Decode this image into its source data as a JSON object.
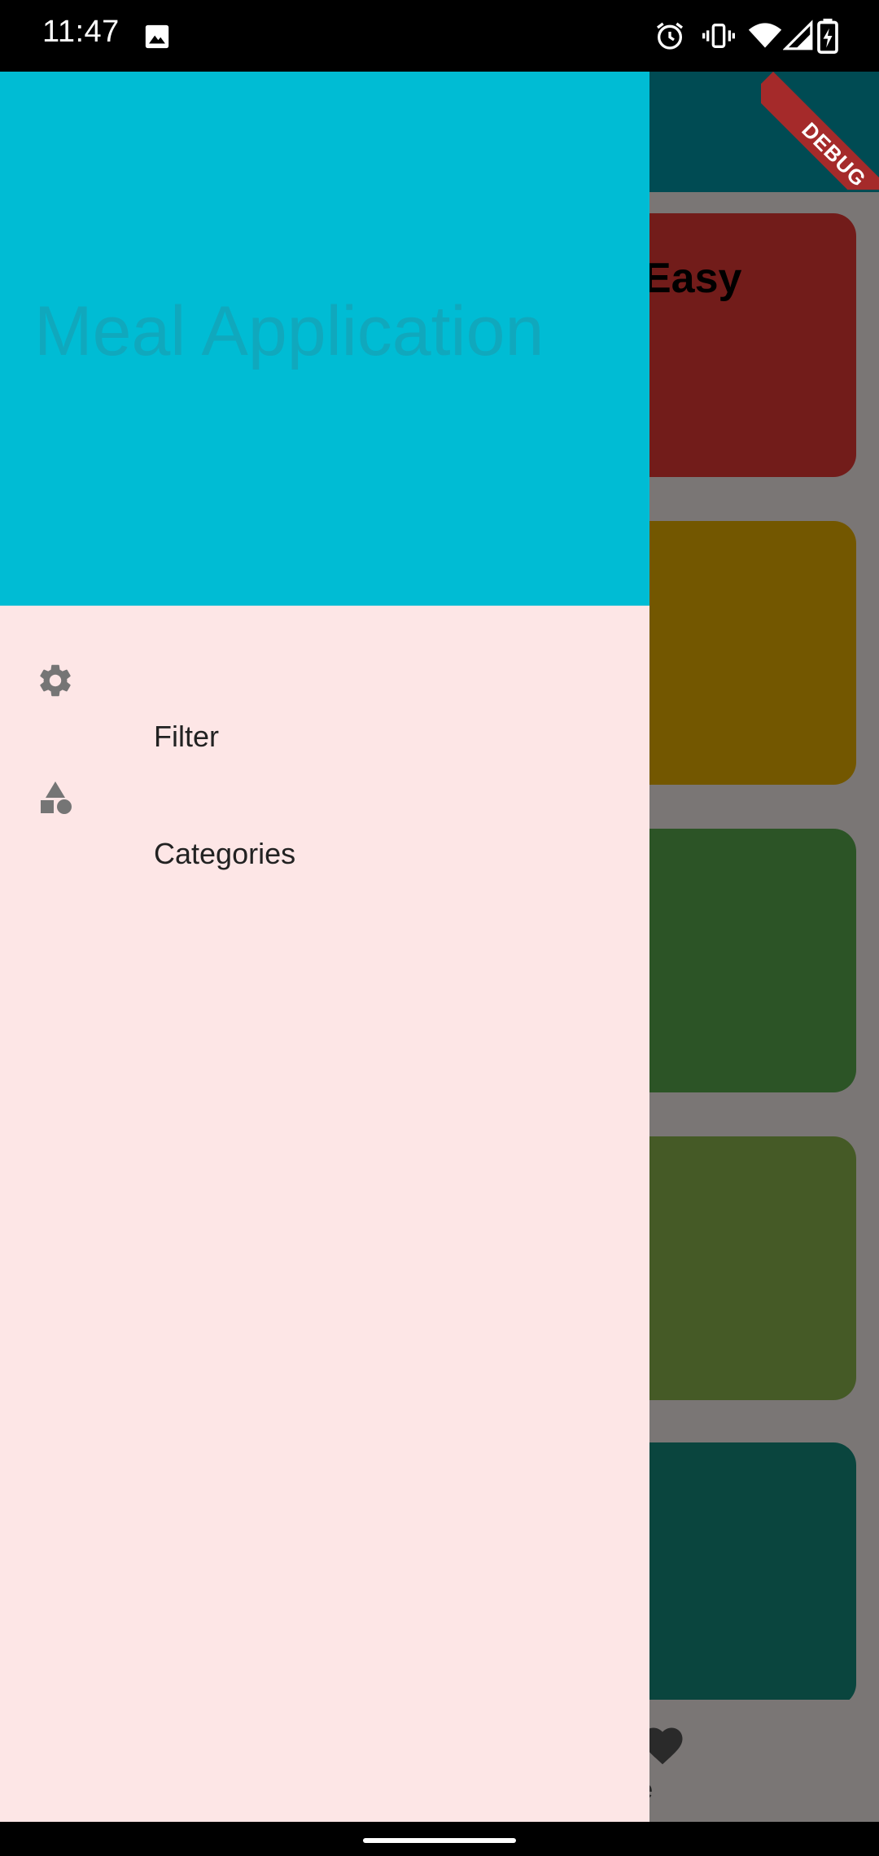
{
  "status_bar": {
    "time": "11:47",
    "icons": [
      "image-notification-icon",
      "alarm-icon",
      "vibrate-icon",
      "wifi-icon",
      "signal-icon",
      "battery-charging-icon"
    ]
  },
  "background": {
    "app_bar_color": "#0097a7",
    "cards": [
      {
        "title": "Easy",
        "color": "#e53935"
      },
      {
        "title": "",
        "color": "#e6ae00"
      },
      {
        "title": "",
        "color": "#59a94c"
      },
      {
        "title": "",
        "color": "#8ab54d"
      },
      {
        "title": "",
        "color": "#148b7c"
      }
    ],
    "bottom_nav": {
      "favorite_label": "orite"
    }
  },
  "debug_banner": {
    "label": "DEBUG",
    "color": "#a52a2a"
  },
  "drawer": {
    "header_color": "#00bcd4",
    "title": "Meal Application",
    "items": [
      {
        "label": "Filter",
        "icon": "gear-icon"
      },
      {
        "label": "Categories",
        "icon": "category-shapes-icon"
      }
    ]
  }
}
